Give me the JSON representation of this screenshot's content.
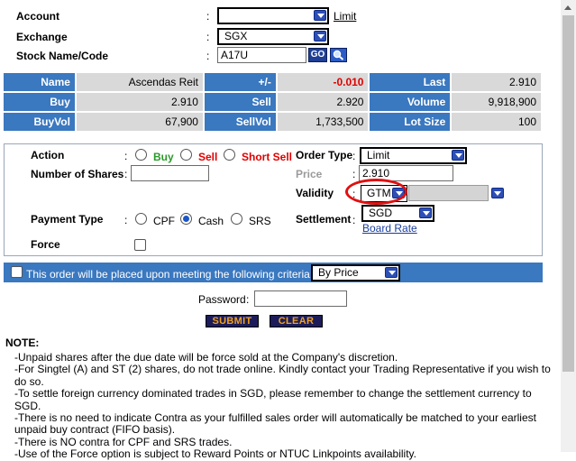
{
  "account": {
    "label": "Account",
    "colon": ":",
    "value": "",
    "link": "Limit"
  },
  "exchange": {
    "label": "Exchange",
    "colon": ":",
    "value": "SGX"
  },
  "stock": {
    "label": "Stock Name/Code",
    "colon": ":",
    "value": "A17U",
    "go_label": "GO"
  },
  "quote": {
    "row1": [
      "Name",
      "Ascendas Reit",
      "+/-",
      "-0.010",
      "Last",
      "2.910"
    ],
    "row2": [
      "Buy",
      "2.910",
      "Sell",
      "2.920",
      "Volume",
      "9,918,900"
    ],
    "row3": [
      "BuyVol",
      "67,900",
      "SellVol",
      "1,733,500",
      "Lot Size",
      "100"
    ],
    "change_color": "#e00000"
  },
  "order": {
    "action_label": "Action",
    "colon": ":",
    "buy": "Buy",
    "sell": "Sell",
    "short_sell": "Short Sell",
    "shares_label": "Number of Shares",
    "shares_value": "",
    "payment_label": "Payment Type",
    "cpf": "CPF",
    "cash": "Cash",
    "srs": "SRS",
    "payment_selected": "Cash",
    "force_label": "Force",
    "order_type_label": "Order Type",
    "order_type_value": "Limit",
    "price_label": "Price",
    "price_value": "2.910",
    "validity_label": "Validity",
    "validity_value": "GTM",
    "validity_extra": "",
    "settlement_label": "Settlement",
    "settlement_value": "SGD",
    "board_rate": "Board Rate"
  },
  "criteria": {
    "label": "This order will be placed upon meeting the following criteria:",
    "value": "By Price"
  },
  "password": {
    "label": "Password",
    "colon": ":",
    "value": ""
  },
  "buttons": {
    "submit": "SUBMIT",
    "clear": "CLEAR"
  },
  "notes": {
    "title": "NOTE:",
    "items": [
      "-Unpaid shares after the due date will be force sold at the Company's discretion.",
      "-For Singtel (A) and ST (2) shares, do not trade online. Kindly contact your Trading Representative if you wish to do so.",
      "-To settle foreign currency dominated trades in SGD, please remember to change the settlement currency to SGD.",
      "-There is no need to indicate Contra as your fulfilled sales order will automatically be matched to your earliest unpaid buy contract (FIFO basis).",
      "-There is NO contra for CPF and SRS trades.",
      "-Use of the Force option is subject to Reward Points or NTUC Linkpoints availability."
    ]
  },
  "colors": {
    "header_blue": "#3a78c0",
    "grey_cell": "#d9d9d9",
    "buy_green": "#2a9a2a",
    "sell_red": "#e00000",
    "highlight_circle": "#e01010"
  }
}
